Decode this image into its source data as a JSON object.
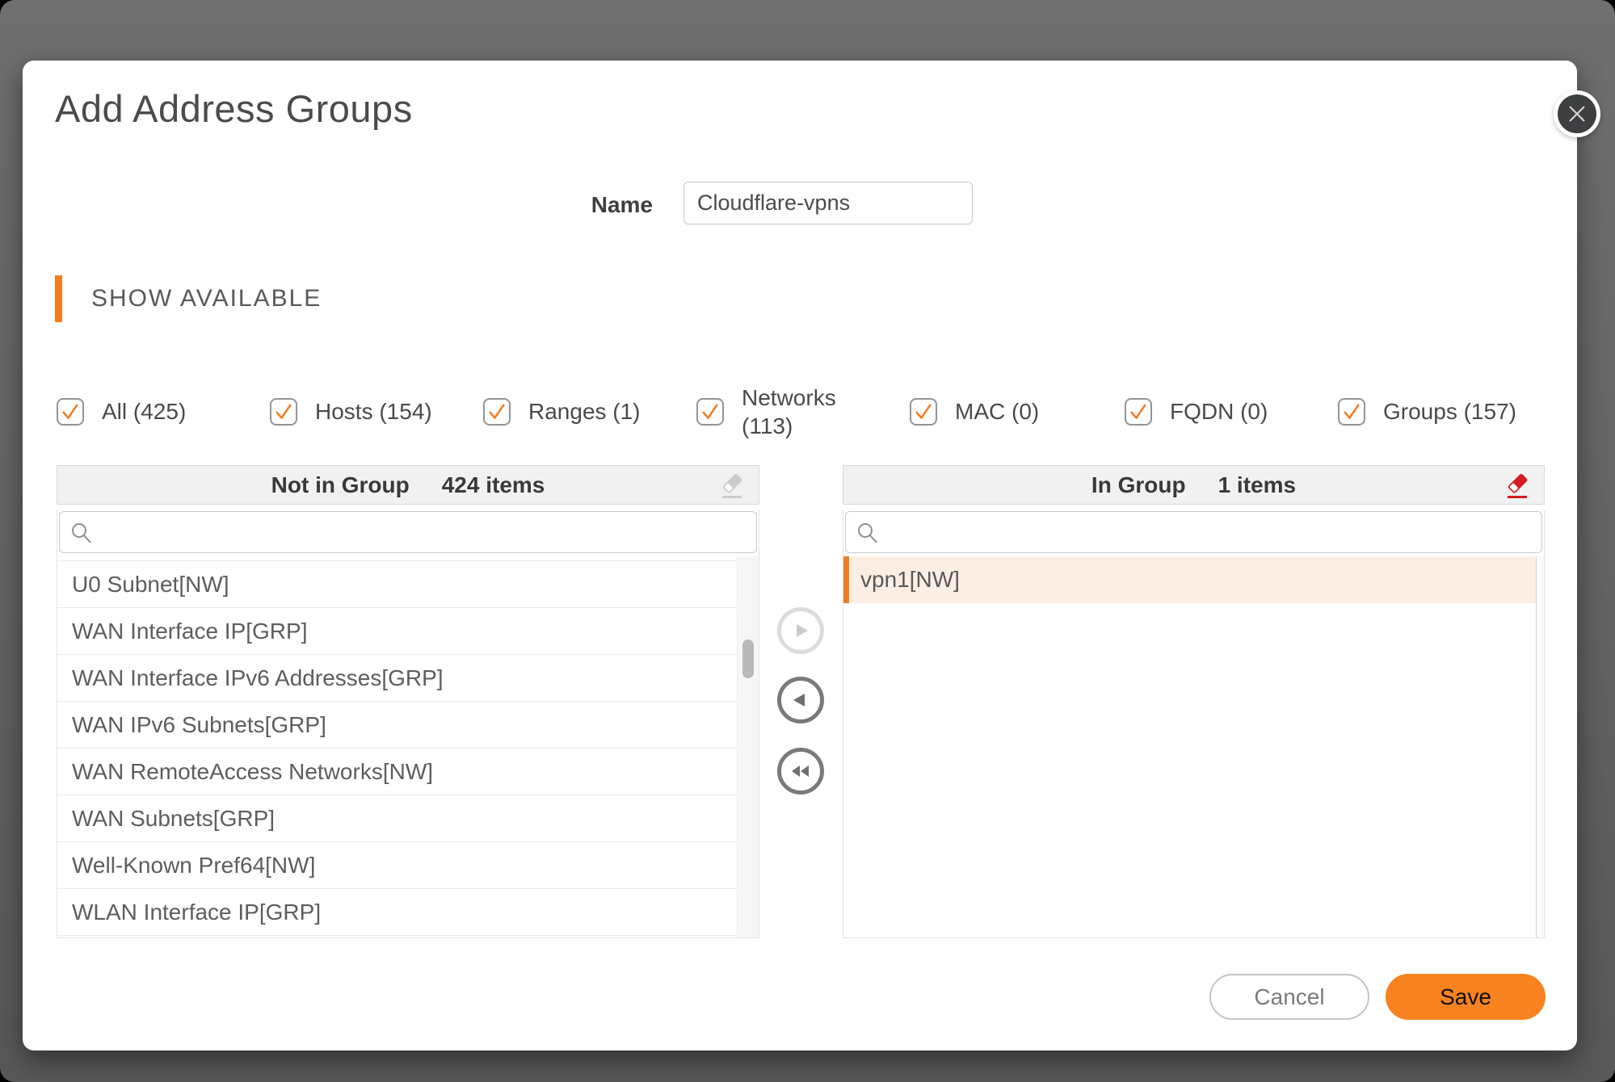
{
  "dialog": {
    "title": "Add Address Groups"
  },
  "name_field": {
    "label": "Name",
    "value": "Cloudflare-vpns"
  },
  "section": {
    "title": "SHOW AVAILABLE"
  },
  "filters": [
    {
      "label": "All (425)",
      "checked": true
    },
    {
      "label": "Hosts (154)",
      "checked": true
    },
    {
      "label": "Ranges (1)",
      "checked": true
    },
    {
      "label": "Networks (113)",
      "checked": true
    },
    {
      "label": "MAC (0)",
      "checked": true
    },
    {
      "label": "FQDN (0)",
      "checked": true
    },
    {
      "label": "Groups (157)",
      "checked": true
    }
  ],
  "left_panel": {
    "title": "Not in Group",
    "count": "424 items",
    "search_value": "",
    "items": [
      {
        "label": "U0 Subnet[NW]"
      },
      {
        "label": "WAN Interface IP[GRP]"
      },
      {
        "label": "WAN Interface IPv6 Addresses[GRP]"
      },
      {
        "label": "WAN IPv6 Subnets[GRP]"
      },
      {
        "label": "WAN RemoteAccess Networks[NW]"
      },
      {
        "label": "WAN Subnets[GRP]"
      },
      {
        "label": "Well-Known Pref64[NW]"
      },
      {
        "label": "WLAN Interface IP[GRP]"
      }
    ]
  },
  "right_panel": {
    "title": "In Group",
    "count": "1 items",
    "search_value": "",
    "items": [
      {
        "label": "vpn1[NW]",
        "selected": true
      }
    ]
  },
  "transfer": {
    "move_right_enabled": false,
    "move_left_enabled": true,
    "move_all_left_enabled": true
  },
  "footer": {
    "cancel_label": "Cancel",
    "save_label": "Save"
  },
  "colors": {
    "accent_orange": "#F47B20",
    "save_orange": "#F8821F",
    "eraser_red": "#D51A21",
    "eraser_gray": "#CBCBCB",
    "selected_row_bg": "#FDEEE3",
    "backdrop_gray": "#666666"
  }
}
